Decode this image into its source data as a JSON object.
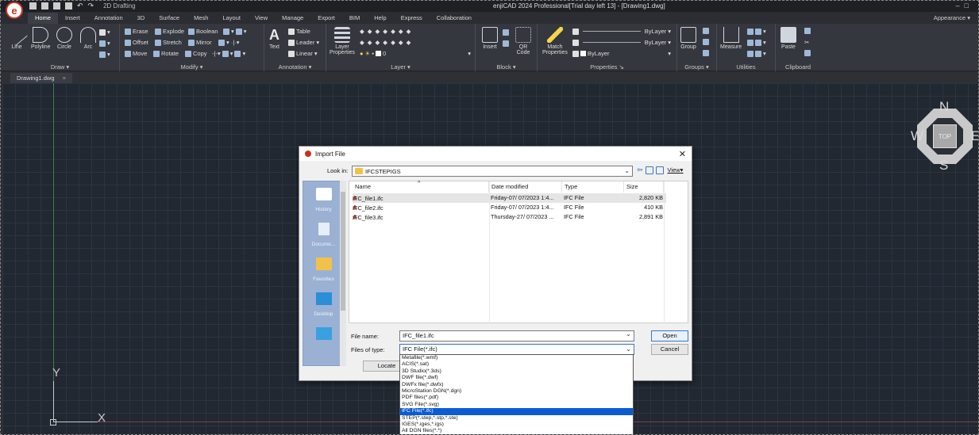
{
  "titlebar": {
    "workspace": "2D Drafting",
    "app_title": "enjiCAD 2024 Professional[Trial day left 13] - [Drawing1.dwg]",
    "logo_letter": "e"
  },
  "tabs": [
    "Home",
    "Insert",
    "Annotation",
    "3D",
    "Surface",
    "Mesh",
    "Layout",
    "View",
    "Manage",
    "Export",
    "BIM",
    "Help",
    "Express",
    "Collaboration"
  ],
  "appearance": "Appearance",
  "ribbon": {
    "draw": {
      "title": "Draw",
      "line": "Line",
      "polyline": "Polyline",
      "circle": "Circle",
      "arc": "Arc"
    },
    "modify": {
      "title": "Modify",
      "erase": "Erase",
      "explode": "Explode",
      "boolean": "Boolean",
      "offset": "Offset",
      "stretch": "Stretch",
      "mirror": "Mirror",
      "move": "Move",
      "rotate": "Rotate",
      "copy": "Copy"
    },
    "annotation": {
      "title": "Annotation",
      "text": "Text",
      "table": "Table",
      "leader": "Leader",
      "linear": "Linear"
    },
    "layer": {
      "title": "Layer",
      "properties_line1": "Layer",
      "properties_line2": "Properties",
      "current_layer": "0"
    },
    "block": {
      "title": "Block",
      "insert": "Insert",
      "qr_line1": "QR",
      "qr_line2": "Code"
    },
    "properties": {
      "title": "Properties",
      "match_line1": "Match",
      "match_line2": "Properties",
      "bylayer1": "ByLayer",
      "bylayer2": "ByLayer",
      "bylayer3": "ByLayer"
    },
    "groups": {
      "title": "Groups",
      "group": "Group"
    },
    "utilities": {
      "title": "Utilities",
      "measure": "Measure"
    },
    "clipboard": {
      "title": "Clipboard",
      "paste": "Paste"
    }
  },
  "doc_tab": "Drawing1.dwg",
  "canvas": {
    "y_axis": "Y",
    "x_axis": "X"
  },
  "viewcube": {
    "n": "N",
    "s": "S",
    "e": "E",
    "w": "W",
    "top": "TOP"
  },
  "dialog": {
    "title": "Import File",
    "look_in_label": "Look in:",
    "look_in_value": "IFCSTEPIGS",
    "view_label": "View",
    "places": [
      "History",
      "Docume...",
      "Favorites",
      "Desktop"
    ],
    "columns": {
      "name": "Name",
      "date": "Date modified",
      "type": "Type",
      "size": "Size"
    },
    "files": [
      {
        "name": "IFC_file1.ifc",
        "date": "Friday-07/ 07/2023 1:4...",
        "type": "IFC File",
        "size": "2,820 KB"
      },
      {
        "name": "IFC_file2.ifc",
        "date": "Friday-07/ 07/2023 1:4...",
        "type": "IFC File",
        "size": "410 KB"
      },
      {
        "name": "IFC_file3.ifc",
        "date": "Thursday-27/ 07/2023 ...",
        "type": "IFC File",
        "size": "2,891 KB"
      }
    ],
    "file_name_label": "File name:",
    "file_name_value": "IFC_file1.ifc",
    "files_of_type_label": "Files of type:",
    "files_of_type_value": "IFC File(*.ifc)",
    "open": "Open",
    "cancel": "Cancel",
    "locate": "Locate"
  },
  "filetype_options": [
    "Metafile(*.wmf)",
    "ACIS(*.sat)",
    "3D Studio(*.3ds)",
    "DWF file(*.dwf)",
    "DWFx file(*.dwfx)",
    "MicroStation DGN(*.dgn)",
    "PDF files(*.pdf)",
    "SVG File(*.svg)",
    "IFC File(*.ifc)",
    "STEP(*.step,*.stp,*.ste)",
    "IGES(*.iges,*.igs)",
    "All DGN files(*.*)"
  ],
  "filetype_selected_index": 8
}
